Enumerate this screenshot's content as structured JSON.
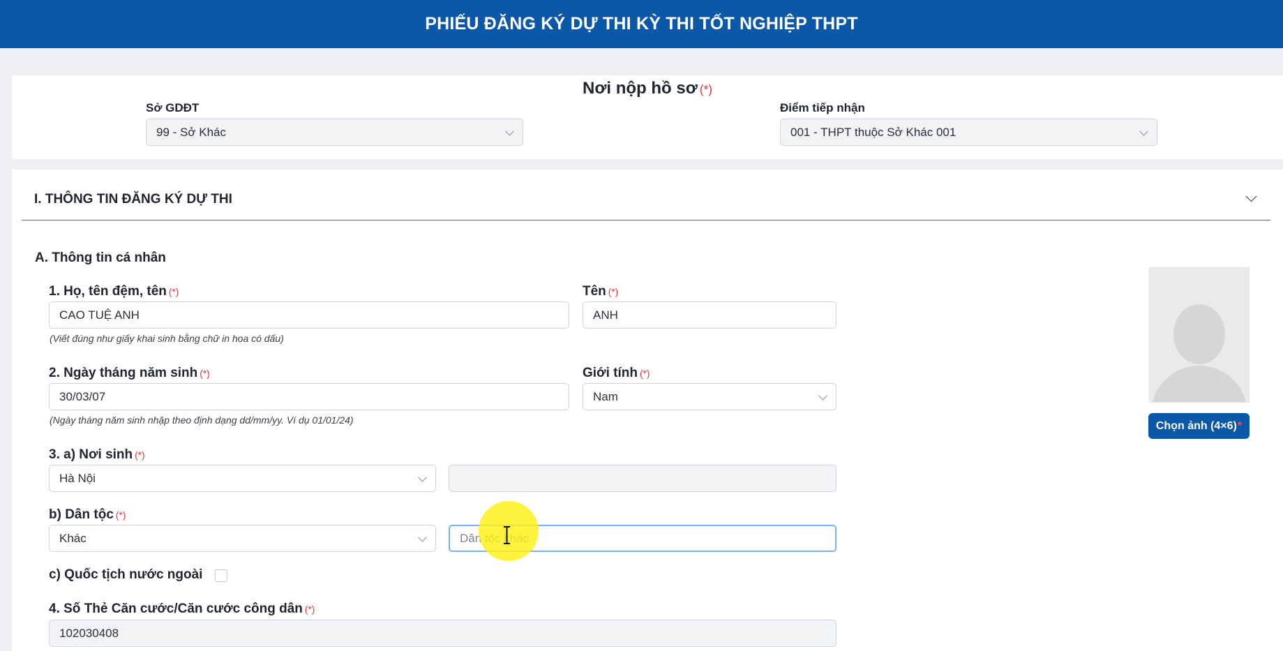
{
  "header": {
    "title": "PHIẾU ĐĂNG KÝ DỰ THI KỲ THI TỐT NGHIỆP THPT"
  },
  "submission": {
    "title": "Nơi nộp hồ sơ",
    "required_mark": "(*)",
    "department": {
      "label": "Sở GDĐT",
      "value": "99 - Sở Khác"
    },
    "receiving_point": {
      "label": "Điểm tiếp nhận",
      "value": "001 - THPT thuộc Sở Khác 001"
    }
  },
  "section": {
    "title": "I. THÔNG TIN ĐĂNG KÝ DỰ THI",
    "subsection": "A. Thông tin cá nhân",
    "full_name": {
      "label": "1. Họ, tên đệm, tên",
      "value": "CAO TUỆ ANH",
      "hint": "(Viết đúng như giấy khai sinh bằng chữ in hoa có dấu)"
    },
    "given_name": {
      "label": "Tên",
      "value": "ANH"
    },
    "dob": {
      "label": "2. Ngày tháng năm sinh",
      "value": "30/03/07",
      "hint": "(Ngày tháng năm sinh nhập theo định dạng dd/mm/yy. Ví dụ 01/01/24)"
    },
    "gender": {
      "label": "Giới tính",
      "value": "Nam"
    },
    "birthplace": {
      "label": "3. a) Nơi sinh",
      "value": "Hà Nội",
      "detail_value": ""
    },
    "ethnicity": {
      "label": "b) Dân tộc",
      "value": "Khác",
      "other_placeholder": "Dân tộc khác"
    },
    "foreign_nationality": {
      "label": "c) Quốc tịch nước ngoài",
      "checked": false
    },
    "id_card": {
      "label": "4. Số Thẻ Căn cước/Căn cước công dân",
      "value": "102030408"
    },
    "required_mark": "(*)"
  },
  "photo": {
    "button_label": "Chọn ảnh (4×6)",
    "button_star": "*"
  },
  "colors": {
    "header": "#0b57a8",
    "required": "#e03535",
    "focus_border": "#7fb0ee",
    "cursor_highlight": "#fff014"
  },
  "icons": [
    "chevron-down-icon",
    "avatar-placeholder-icon",
    "text-cursor-icon"
  ]
}
